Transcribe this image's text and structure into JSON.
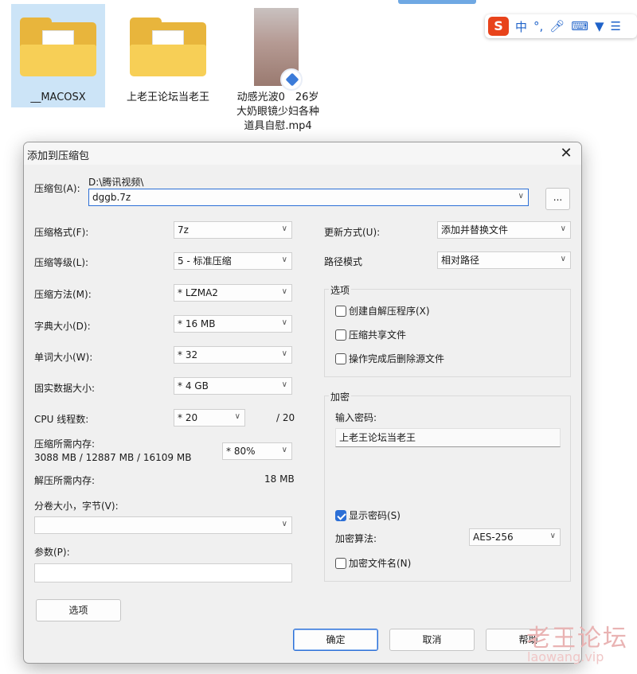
{
  "desktop": {
    "items": [
      {
        "label": "__MACOSX"
      },
      {
        "label": "上老王论坛当老王"
      },
      {
        "label": "动感光波0　26岁大奶眼镜少妇各种道具自慰.mp4"
      }
    ]
  },
  "ime": {
    "logo": "S",
    "lang": "中",
    "punct": "°,"
  },
  "dialog": {
    "title": "添加到压缩包",
    "archive_label": "压缩包(A):",
    "archive_path": "D:\\腾讯视频\\",
    "archive_name": "dggb.7z",
    "browse_label": "...",
    "format_label": "压缩格式(F):",
    "format_value": "7z",
    "level_label": "压缩等级(L):",
    "level_value": "5 - 标准压缩",
    "method_label": "压缩方法(M):",
    "method_value": "*  LZMA2",
    "dict_label": "字典大小(D):",
    "dict_value": "*  16 MB",
    "word_label": "单词大小(W):",
    "word_value": "*  32",
    "solid_label": "固实数据大小:",
    "solid_value": "*  4 GB",
    "threads_label": "CPU 线程数:",
    "threads_value": "*  20",
    "threads_total": "/ 20",
    "mem_label": "压缩所需内存:",
    "mem_detail": "3088 MB / 12887 MB / 16109 MB",
    "mem_value": "*  80%",
    "decomp_label": "解压所需内存:",
    "decomp_value": "18 MB",
    "split_label": "分卷大小，字节(V):",
    "split_value": "",
    "params_label": "参数(P):",
    "params_value": "",
    "options_button": "选项",
    "update_label": "更新方式(U):",
    "update_value": "添加并替换文件",
    "path_label": "路径模式",
    "path_value": "相对路径",
    "options_group_title": "选项",
    "opt_sfx": "创建自解压程序(X)",
    "opt_shared": "压缩共享文件",
    "opt_delete": "操作完成后删除源文件",
    "encrypt_group_title": "加密",
    "password_label": "输入密码:",
    "password_value": "上老王论坛当老王",
    "show_password": "显示密码(S)",
    "show_password_checked": true,
    "enc_method_label": "加密算法:",
    "enc_method_value": "AES-256",
    "encrypt_names": "加密文件名(N)",
    "ok_button": "确定",
    "cancel_button": "取消",
    "help_button": "帮助"
  },
  "watermark": {
    "line1": "老王论坛",
    "line2": "laowang.vip"
  }
}
